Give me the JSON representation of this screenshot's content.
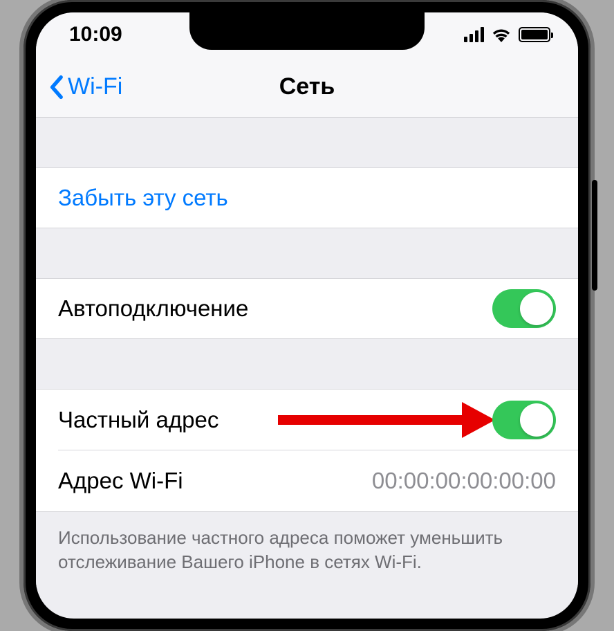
{
  "status": {
    "time": "10:09"
  },
  "nav": {
    "back_label": "Wi-Fi",
    "title": "Сеть"
  },
  "sections": {
    "forget": {
      "label": "Забыть эту сеть"
    },
    "autoconnect": {
      "label": "Автоподключение",
      "enabled": true
    },
    "private_address": {
      "label": "Частный адрес",
      "enabled": true
    },
    "wifi_address": {
      "label": "Адрес Wi-Fi",
      "value": "00:00:00:00:00:00"
    }
  },
  "footer": {
    "text": "Использование частного адреса поможет уменьшить отслеживание Вашего iPhone в сетях Wi-Fi."
  }
}
